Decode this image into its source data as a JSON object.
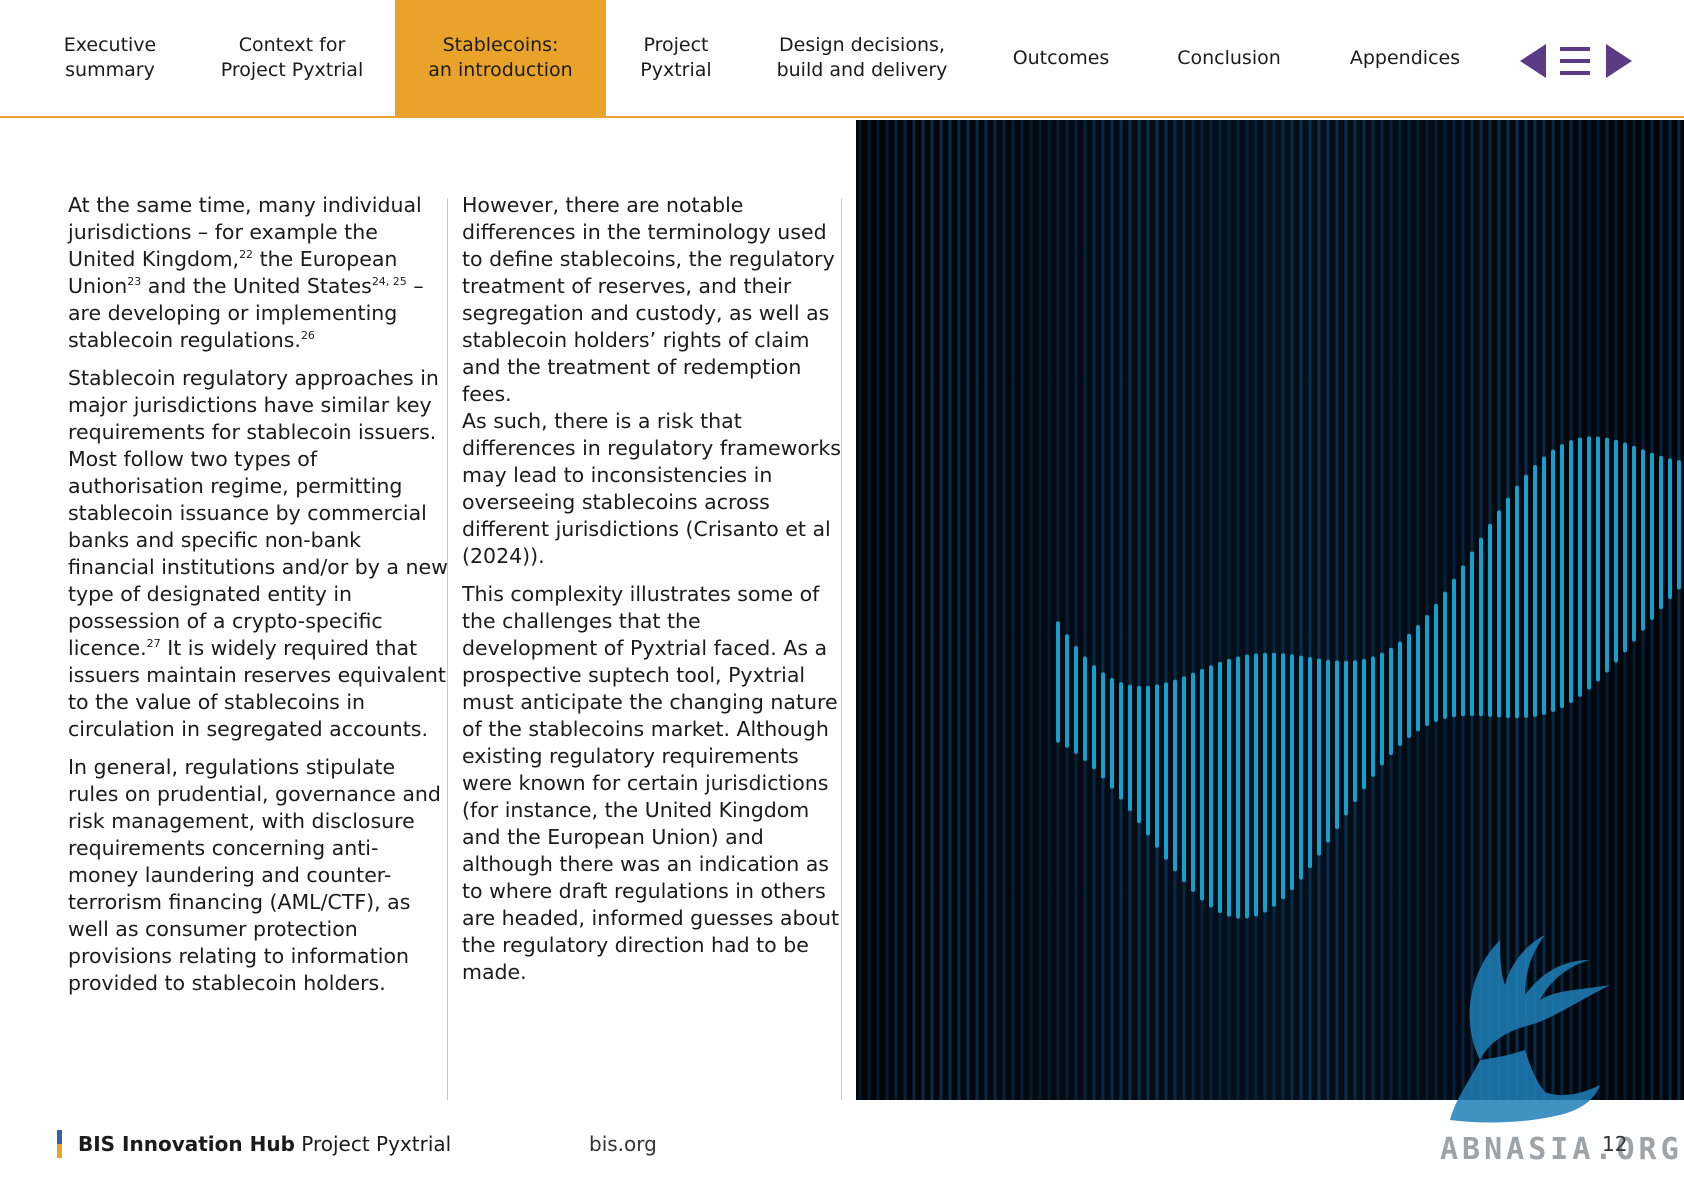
{
  "nav": {
    "tabs": [
      {
        "label": "Executive\nsummary",
        "active": false
      },
      {
        "label": "Context for\nProject Pyxtrial",
        "active": false
      },
      {
        "label": "Stablecoins:\nan introduction",
        "active": true
      },
      {
        "label": "Project\nPyxtrial",
        "active": false
      },
      {
        "label": "Design decisions,\nbuild and delivery",
        "active": false
      },
      {
        "label": "Outcomes",
        "active": false
      },
      {
        "label": "Conclusion",
        "active": false
      },
      {
        "label": "Appendices",
        "active": false
      }
    ],
    "controls": {
      "prev_icon": "triangle-left-icon",
      "menu_icon": "hamburger-menu-icon",
      "next_icon": "triangle-right-icon"
    },
    "accent_color": "#e9a32a",
    "icon_color": "#5b3a86"
  },
  "column1": {
    "p1": {
      "t1": "At the same time, many individual jurisdictions – for example the United Kingdom,",
      "s1": "22",
      "t2": " the European Union",
      "s2": "23",
      "t3": " and the United States",
      "s3": "24, 25",
      "t4": " – are developing or implementing stablecoin regulations.",
      "s4": "26"
    },
    "p2": {
      "t1": "Stablecoin regulatory approaches in major jurisdictions have similar key requirements for stablecoin issuers. Most follow two types of authorisation regime, permitting stablecoin issuance by commercial banks and specific non-bank financial institutions and/or by a new type of designated entity in possession of a crypto-specific licence.",
      "s1": "27",
      "t2": " It is widely required that issuers maintain reserves equivalent to the value of stablecoins in circulation in segregated accounts."
    },
    "p3": "In general, regulations stipulate rules on prudential, governance and risk management, with disclosure requirements concerning anti-money laundering and counter-terrorism financing (AML/CTF), as well as consumer protection provisions relating to information provided to stablecoin holders."
  },
  "column2": {
    "p1": "However, there are notable differences in the terminology used to define stablecoins, the regulatory treatment of reserves, and their segregation and custody, as well as stablecoin holders’ rights of claim and the treatment of redemption fees.",
    "p1b": "As such, there is a risk that differences in regulatory frameworks may lead to inconsistencies in overseeing stablecoins across different jurisdictions (Crisanto et al (2024)).",
    "p2": "This complexity illustrates some of the challenges that the development of Pyxtrial faced. As a prospective suptech tool, Pyxtrial must anticipate the changing nature of the stablecoins market. Although existing regulatory requirements were known for certain jurisdictions (for instance, the United Kingdom and the European Union) and although there was an indication as to where draft regulations in others are headed, informed guesses about the regulatory direction had to be made."
  },
  "footer": {
    "brand_bold": "BIS Innovation Hub",
    "brand_rest": " Project Pyxtrial",
    "site": "bis.org",
    "page_number": "12"
  },
  "watermark": {
    "text": "ABNASIA.ORG",
    "icon": "griffin-logo-icon"
  }
}
